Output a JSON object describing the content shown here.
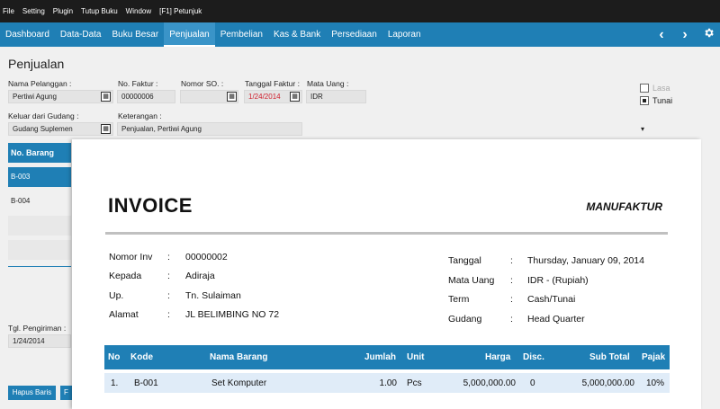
{
  "menubar": [
    "File",
    "Setting",
    "Plugin",
    "Tutup Buku",
    "Window",
    "[F1] Petunjuk"
  ],
  "navbar": {
    "items": [
      "Dashboard",
      "Data-Data",
      "Buku Besar",
      "Penjualan",
      "Pembelian",
      "Kas & Bank",
      "Persediaan",
      "Laporan"
    ],
    "active": "Penjualan",
    "back_icon": "chevron-left-icon",
    "forward_icon": "chevron-right-icon",
    "settings_icon": "gear-icon"
  },
  "form": {
    "title": "Penjualan",
    "nama_pelanggan_label": "Nama Pelanggan :",
    "nama_pelanggan": "Pertiwi Agung",
    "no_faktur_label": "No. Faktur :",
    "no_faktur": "00000006",
    "nomor_so_label": "Nomor SO. :",
    "nomor_so": "",
    "tanggal_faktur_label": "Tanggal Faktur :",
    "tanggal_faktur": "1/24/2014",
    "mata_uang_label": "Mata Uang :",
    "mata_uang": "IDR",
    "keluar_gudang_label": "Keluar dari Gudang :",
    "keluar_gudang": "Gudang Suplemen",
    "keterangan_label": "Keterangan :",
    "keterangan": "Penjualan, Pertiwi Agung",
    "lasa_label": "Lasa",
    "tunai_label": "Tunai",
    "tgl_pengiriman_label": "Tgl. Pengiriman :",
    "tgl_pengiriman": "1/24/2014",
    "dropdown_glyph": "▾"
  },
  "left_table": {
    "header": "No. Barang",
    "rows": [
      "B-003",
      "B-004",
      "",
      ""
    ]
  },
  "buttons": {
    "hapus_baris": "Hapus Baris",
    "partial": "F"
  },
  "invoice": {
    "title": "INVOICE",
    "company": "MANUFAKTUR",
    "left_labels": [
      "Nomor Inv",
      "Kepada",
      "Up.",
      "Alamat"
    ],
    "left_values": [
      "00000002",
      "Adiraja",
      "Tn. Sulaiman",
      "JL BELIMBING NO 72"
    ],
    "right_labels": [
      "Tanggal",
      "Mata Uang",
      "Term",
      "Gudang"
    ],
    "right_values": [
      "Thursday, January 09, 2014",
      "IDR - (Rupiah)",
      "Cash/Tunai",
      "Head Quarter"
    ],
    "colon": ":",
    "columns": [
      "No",
      "Kode",
      "Nama Barang",
      "Jumlah",
      "Unit",
      "Harga",
      "Disc.",
      "Sub Total",
      "Pajak"
    ],
    "items": [
      {
        "no": "1.",
        "kode": "B-001",
        "nama": "Set Komputer",
        "jumlah": "1.00",
        "unit": "Pcs",
        "harga": "5,000,000.00",
        "disc": "0",
        "subtotal": "5,000,000.00",
        "pajak": "10%"
      }
    ]
  }
}
